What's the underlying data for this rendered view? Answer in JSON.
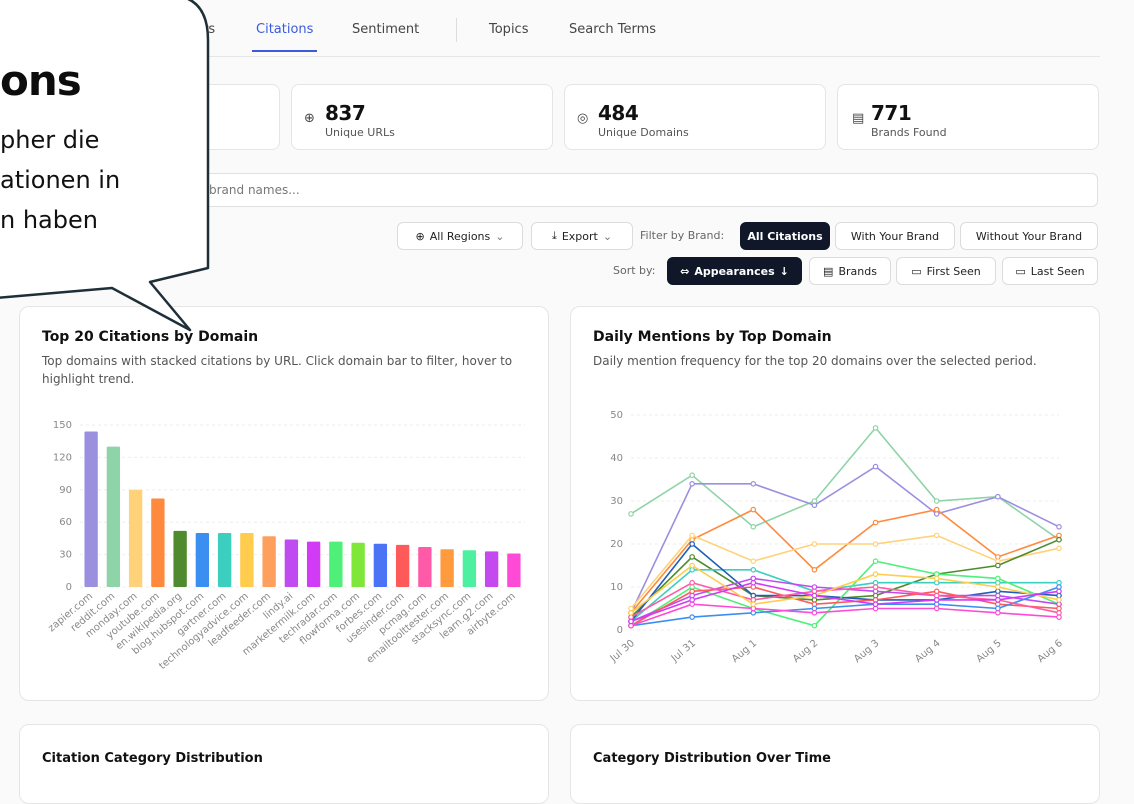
{
  "tabs": [
    {
      "label": "rs",
      "left": 203
    },
    {
      "label": "Citations",
      "left": 256,
      "active": true
    },
    {
      "label": "Sentiment",
      "left": 352
    },
    {
      "label": "Topics",
      "left": 489
    },
    {
      "label": "Search Terms",
      "left": 569
    }
  ],
  "stats": [
    {
      "value": "837",
      "label": "Unique URLs",
      "icon": "globe-icon"
    },
    {
      "value": "484",
      "label": "Unique Domains",
      "icon": "network-icon"
    },
    {
      "value": "771",
      "label": "Brands Found",
      "icon": "building-icon"
    }
  ],
  "search": {
    "placeholder": "brand names..."
  },
  "toolbar": {
    "regions": "All Regions",
    "export": "Export",
    "filter_label": "Filter by Brand:",
    "filters": [
      "All Citations",
      "With Your Brand",
      "Without Your Brand"
    ],
    "sort_label": "Sort by:",
    "sorts": [
      "Appearances",
      "Brands",
      "First Seen",
      "Last Seen"
    ]
  },
  "callout": {
    "title": "ons",
    "lines": [
      "pher die",
      "ationen in",
      "n haben"
    ]
  },
  "panels": {
    "bar": {
      "title": "Top 20 Citations by Domain",
      "desc": "Top domains with stacked citations by URL. Click domain bar to filter, hover to highlight trend."
    },
    "line": {
      "title": "Daily Mentions by Top Domain",
      "desc": "Daily mention frequency for the top 20 domains over the selected period."
    },
    "bottom_left": {
      "title": "Citation Category Distribution"
    },
    "bottom_right": {
      "title": "Category Distribution Over Time"
    }
  },
  "chart_data": [
    {
      "type": "bar",
      "title": "Top 20 Citations by Domain",
      "categories": [
        "zapier.com",
        "reddit.com",
        "monday.com",
        "youtube.com",
        "en.wikipedia.org",
        "blog.hubspot.com",
        "gartner.com",
        "technologyadvice.com",
        "leadfeeder.com",
        "lindy.ai",
        "marketermilk.com",
        "techradar.com",
        "flowforma.com",
        "forbes.com",
        "usesinder.com",
        "pcmag.com",
        "emailtoolttester.com",
        "stacksync.com",
        "learn.g2.com",
        "airbyte.com"
      ],
      "values": [
        144,
        130,
        90,
        82,
        52,
        50,
        50,
        50,
        47,
        44,
        42,
        42,
        41,
        40,
        39,
        37,
        35,
        34,
        33,
        31
      ],
      "colors": [
        "#9b8fe0",
        "#8fd3a8",
        "#ffd27a",
        "#ff8a3d",
        "#4f8a2e",
        "#3b8ff0",
        "#3ccfbf",
        "#ffcc4d",
        "#ff9f5e",
        "#c04bf0",
        "#d13bf5",
        "#4ef07a",
        "#7fe63a",
        "#4a74f5",
        "#ff5a5a",
        "#ff5aa8",
        "#ff9a3d",
        "#4cf0a0",
        "#c44af0",
        "#ff4ad8"
      ],
      "ylim": [
        0,
        150
      ],
      "yticks": [
        0,
        30,
        60,
        90,
        120,
        150
      ]
    },
    {
      "type": "line",
      "title": "Daily Mentions by Top Domain",
      "x": [
        "Jul 30",
        "Jul 31",
        "Aug 1",
        "Aug 2",
        "Aug 3",
        "Aug 4",
        "Aug 5",
        "Aug 6"
      ],
      "ylim": [
        0,
        50
      ],
      "yticks": [
        0,
        10,
        20,
        30,
        40,
        50
      ],
      "series": [
        {
          "color": "#8fd3a8",
          "values": [
            27,
            36,
            24,
            30,
            47,
            30,
            31,
            21
          ]
        },
        {
          "color": "#9b8fe0",
          "values": [
            4,
            34,
            34,
            29,
            38,
            27,
            31,
            24
          ]
        },
        {
          "color": "#ff8a3d",
          "values": [
            4,
            21,
            28,
            14,
            25,
            28,
            17,
            22
          ]
        },
        {
          "color": "#ffd27a",
          "values": [
            5,
            22,
            16,
            20,
            20,
            22,
            16,
            19
          ]
        },
        {
          "color": "#4f8a2e",
          "values": [
            3,
            17,
            8,
            7,
            8,
            13,
            15,
            21
          ]
        },
        {
          "color": "#3ccfbf",
          "values": [
            2,
            14,
            14,
            9,
            11,
            11,
            11,
            11
          ]
        },
        {
          "color": "#1e5fb4",
          "values": [
            2,
            20,
            8,
            8,
            7,
            7,
            9,
            8
          ]
        },
        {
          "color": "#4ef07a",
          "values": [
            1,
            10,
            5,
            1,
            16,
            13,
            12,
            6
          ]
        },
        {
          "color": "#c04bf0",
          "values": [
            2,
            8,
            12,
            10,
            9,
            8,
            8,
            6
          ]
        },
        {
          "color": "#ff5a5a",
          "values": [
            1,
            9,
            10,
            6,
            7,
            9,
            6,
            5
          ]
        },
        {
          "color": "#3b8ff0",
          "values": [
            1,
            3,
            4,
            5,
            6,
            6,
            5,
            10
          ]
        },
        {
          "color": "#ff4ad8",
          "values": [
            1,
            6,
            5,
            4,
            5,
            5,
            4,
            3
          ]
        },
        {
          "color": "#ff5aa8",
          "values": [
            3,
            11,
            7,
            9,
            10,
            8,
            7,
            4
          ]
        },
        {
          "color": "#ffcc4d",
          "values": [
            4,
            15,
            6,
            8,
            13,
            12,
            10,
            7
          ]
        },
        {
          "color": "#d13bf5",
          "values": [
            2,
            7,
            11,
            8,
            6,
            7,
            7,
            9
          ]
        }
      ]
    }
  ]
}
